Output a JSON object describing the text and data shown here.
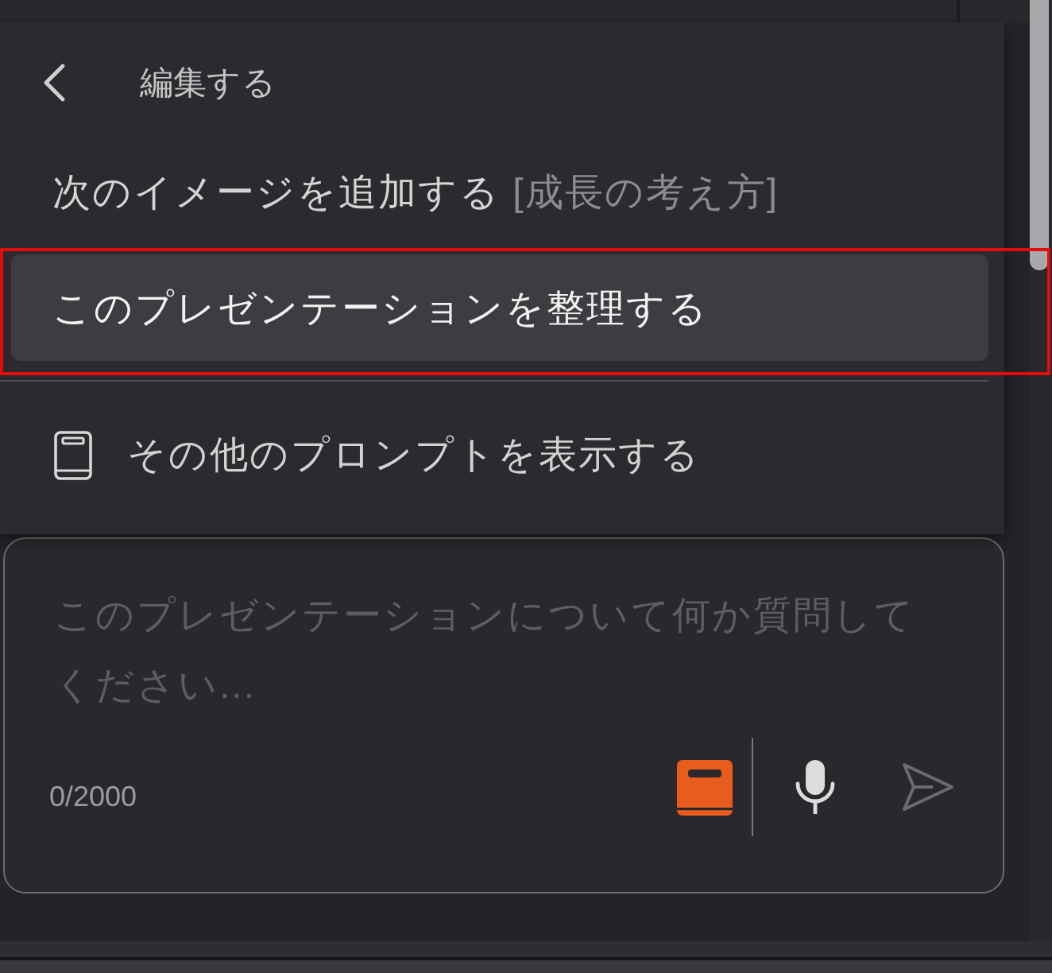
{
  "menu": {
    "title": "編集する",
    "items": [
      {
        "kind": "prompt",
        "label": "次のイメージを追加する",
        "detail": "[成長の考え方]",
        "selected": false,
        "annotated": false
      },
      {
        "kind": "prompt",
        "label": "このプレゼンテーションを整理する",
        "selected": true,
        "annotated": true
      }
    ],
    "more_prompts": {
      "label": "その他のプロンプトを表示する"
    }
  },
  "composer": {
    "placeholder": "このプレゼンテーションについて何か質問してください...",
    "counter": "0/2000",
    "prompt_button_active": true,
    "send_disabled": true
  }
}
